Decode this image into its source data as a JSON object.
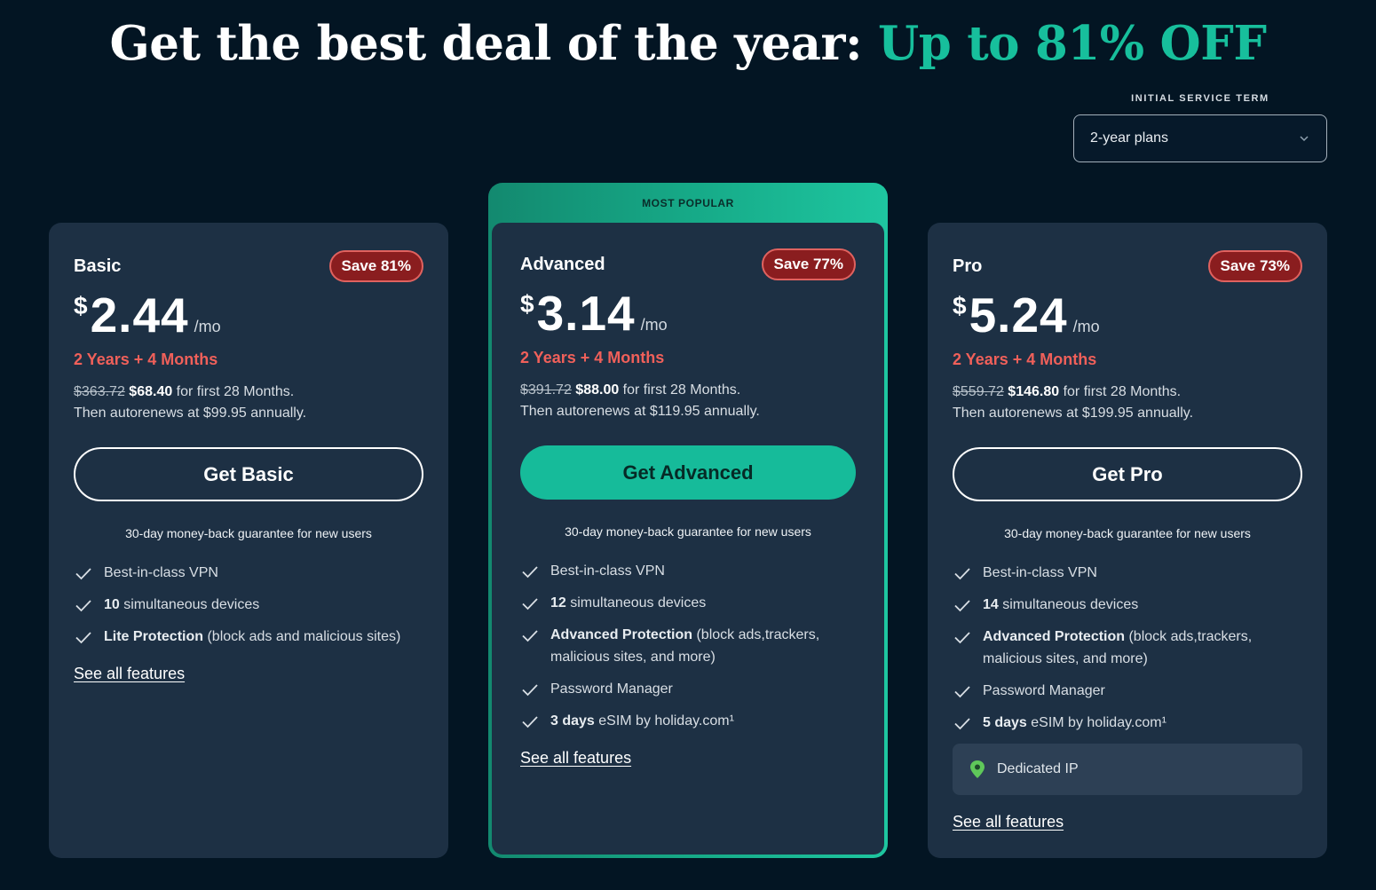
{
  "headline": {
    "main": "Get the best deal of the year: ",
    "accent": "Up to 81% OFF"
  },
  "term": {
    "label": "INITIAL SERVICE TERM",
    "selected": "2-year plans"
  },
  "colors": {
    "accent": "#17bf9c",
    "term_red": "#f0605a",
    "card_bg": "#1d3044",
    "page_bg": "#031523"
  },
  "shared": {
    "guarantee": "30-day money-back guarantee for new users",
    "see_all": "See all features"
  },
  "plans": {
    "basic": {
      "name": "Basic",
      "save": "Save 81%",
      "currency": "$",
      "price": "2.44",
      "per": "/mo",
      "term": "2 Years + 4 Months",
      "original": "$363.72",
      "discounted": "$68.40",
      "for_first": " for first 28 Months.",
      "renews": "Then autorenews at $99.95 annually.",
      "cta": "Get Basic",
      "features": [
        {
          "bold": "",
          "text": "Best-in-class VPN"
        },
        {
          "bold": "10",
          "text": " simultaneous devices"
        },
        {
          "bold": "Lite Protection",
          "text": " (block ads and malicious sites)"
        }
      ]
    },
    "advanced": {
      "ribbon": "MOST POPULAR",
      "name": "Advanced",
      "save": "Save 77%",
      "currency": "$",
      "price": "3.14",
      "per": "/mo",
      "term": "2 Years + 4 Months",
      "original": "$391.72",
      "discounted": "$88.00",
      "for_first": " for first 28 Months.",
      "renews": "Then autorenews at $119.95 annually.",
      "cta": "Get Advanced",
      "features": [
        {
          "bold": "",
          "text": "Best-in-class VPN"
        },
        {
          "bold": "12",
          "text": " simultaneous devices"
        },
        {
          "bold": "Advanced Protection",
          "text": " (block ads,trackers, malicious sites, and more)"
        },
        {
          "bold": "",
          "text": "Password Manager"
        },
        {
          "bold": "3 days",
          "text": " eSIM by holiday.com¹"
        }
      ]
    },
    "pro": {
      "name": "Pro",
      "save": "Save 73%",
      "currency": "$",
      "price": "5.24",
      "per": "/mo",
      "term": "2 Years + 4 Months",
      "original": "$559.72",
      "discounted": "$146.80",
      "for_first": " for first 28 Months.",
      "renews": "Then autorenews at $199.95 annually.",
      "cta": "Get Pro",
      "features": [
        {
          "bold": "",
          "text": "Best-in-class VPN"
        },
        {
          "bold": "14",
          "text": " simultaneous devices"
        },
        {
          "bold": "Advanced Protection",
          "text": " (block ads,trackers, malicious sites, and more)"
        },
        {
          "bold": "",
          "text": "Password Manager"
        },
        {
          "bold": "5 days",
          "text": " eSIM by holiday.com¹"
        }
      ],
      "extra": {
        "icon": "location-pin-icon",
        "label": "Dedicated IP"
      }
    }
  }
}
